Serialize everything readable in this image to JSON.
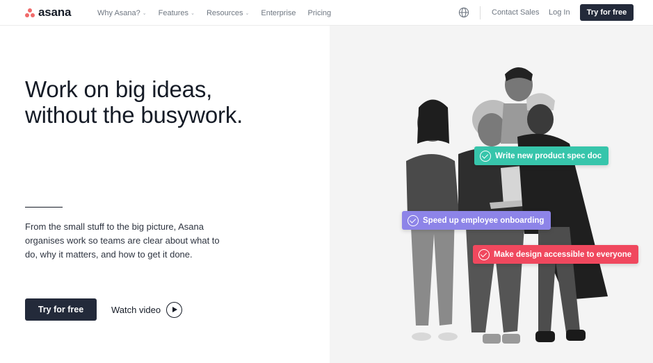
{
  "brand": {
    "name": "asana",
    "accent": "#f06a6a"
  },
  "nav": {
    "links": [
      {
        "label": "Why Asana?",
        "has_dropdown": true
      },
      {
        "label": "Features",
        "has_dropdown": true
      },
      {
        "label": "Resources",
        "has_dropdown": true
      },
      {
        "label": "Enterprise",
        "has_dropdown": false
      },
      {
        "label": "Pricing",
        "has_dropdown": false
      }
    ],
    "globe_icon": "globe-icon",
    "contact_label": "Contact Sales",
    "login_label": "Log In",
    "cta_label": "Try for free",
    "chevron": "⌄"
  },
  "hero": {
    "headline_line1": "Work on big ideas,",
    "headline_line2": "without the busywork.",
    "description": "From the small stuff to the big picture, Asana organises work so teams are clear about what to do, why it matters, and how to get it done.",
    "cta_label": "Try for free",
    "watch_label": "Watch video",
    "tasks": [
      {
        "label": "Write new product spec doc",
        "color": "#37c5ab"
      },
      {
        "label": "Speed up employee onboarding",
        "color": "#8d84e8"
      },
      {
        "label": "Make design accessible to everyone",
        "color": "#f0485e"
      }
    ]
  },
  "colors": {
    "dark_button": "#232a3a",
    "hero_bg": "#f4f4f4"
  }
}
